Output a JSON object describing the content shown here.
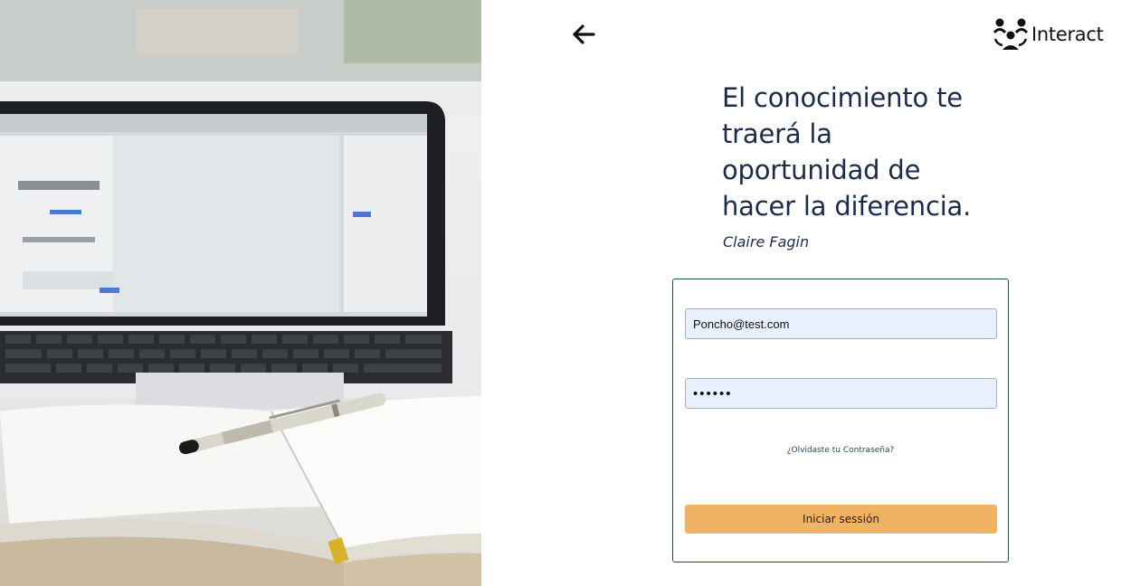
{
  "header": {
    "back_icon": "arrow-left-icon",
    "logo_icon": "people-group-icon",
    "logo_text": "Interact"
  },
  "quote": {
    "lines": [
      "El conocimiento te",
      "traerá la",
      "oportunidad de",
      "hacer la diferencia."
    ],
    "author": "Claire Fagin"
  },
  "login": {
    "email_value": "Poncho@test.com",
    "password_value": "123456",
    "forgot_label": "¿Olvidaste tu Contraseña?",
    "submit_label": "Iniciar sessión"
  },
  "colors": {
    "text_primary": "#1c2b4a",
    "card_border": "#1f4e5a",
    "input_bg": "#e8f0fe",
    "button_bg": "#f0b363"
  }
}
